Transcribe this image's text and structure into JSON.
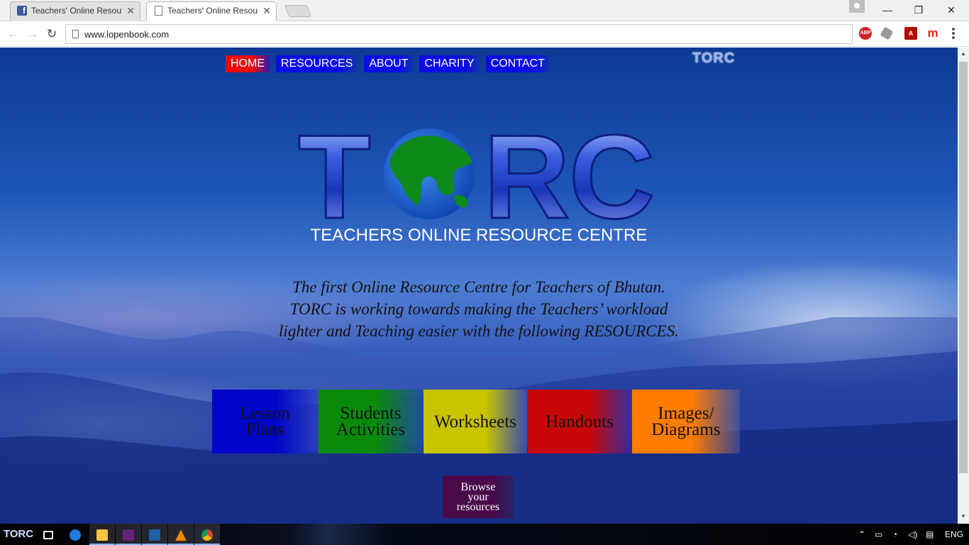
{
  "browser": {
    "tabs": [
      {
        "title": "Teachers' Online Resourc",
        "favicon": "facebook-icon",
        "active": false
      },
      {
        "title": "Teachers' Online Resourc",
        "favicon": "page-icon",
        "active": true
      }
    ],
    "url": "www.lopenbook.com",
    "close_glyph": "✕",
    "window_controls": {
      "minimize": "—",
      "restore": "❐",
      "close": "✕"
    },
    "extensions": {
      "abp": "ABP",
      "pdf": "A",
      "m": "m"
    }
  },
  "site": {
    "nav": {
      "home": "HOME",
      "resources": "RESOURCES",
      "about": "ABOUT",
      "charity": "CHARITY",
      "contact": "CONTACT"
    },
    "small_logo": "TORC",
    "big_logo": {
      "letters": [
        "T",
        "R",
        "C"
      ]
    },
    "tagline": "TEACHERS ONLINE RESOURCE CENTRE",
    "intro": {
      "line1": "The first Online Resource Centre for Teachers of Bhutan.",
      "line2": "TORC is working towards making the Teachers’ workload",
      "line3": "lighter and Teaching easier with the following RESOURCES."
    },
    "cards": [
      {
        "line1": "Lesson",
        "line2": "Plans"
      },
      {
        "line1": "Students",
        "line2": "Activities"
      },
      {
        "line1": "Worksheets",
        "line2": ""
      },
      {
        "line1": "Handouts",
        "line2": ""
      },
      {
        "line1": "Images/",
        "line2": "Diagrams"
      }
    ],
    "browse": {
      "line1": "Browse",
      "line2": "your",
      "line3": "resources"
    },
    "colors": {
      "home": "#ee0a0a",
      "nav": "#0b0be8",
      "lesson": "#0005c8",
      "students": "#0a8a0a",
      "worksheets": "#c8c400",
      "handouts": "#c80808",
      "images": "#ff7c00",
      "browse": "#4a0a4a"
    }
  },
  "taskbar": {
    "start": "TORC",
    "language": "ENG"
  }
}
